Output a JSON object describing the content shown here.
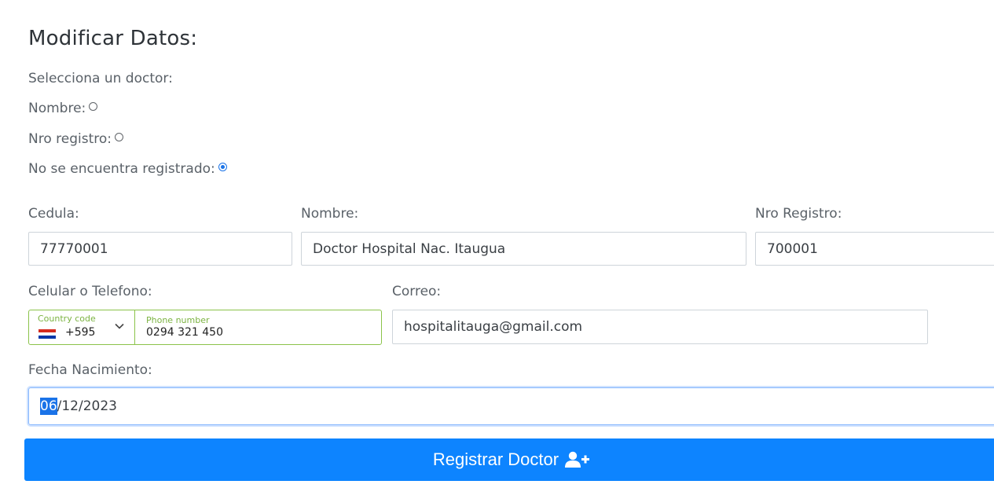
{
  "form": {
    "title": "Modificar Datos:",
    "select_doctor_label": "Selecciona un doctor:",
    "radios": [
      {
        "label": "Nombre:",
        "checked": false
      },
      {
        "label": "Nro registro:",
        "checked": false
      },
      {
        "label": "No se encuentra registrado:",
        "checked": true
      }
    ],
    "cedula": {
      "label": "Cedula:",
      "value": "77770001"
    },
    "nombre": {
      "label": "Nombre:",
      "value": "Doctor Hospital Nac. Itaugua"
    },
    "nro_registro": {
      "label": "Nro Registro:",
      "value": "700001"
    },
    "telefono": {
      "label": "Celular o Telefono:",
      "country_code_label": "Country code",
      "country_code": "+595",
      "country_flag": "paraguay-flag-icon",
      "phone_label": "Phone number",
      "phone": "0294 321 450"
    },
    "correo": {
      "label": "Correo:",
      "value": "hospitalitauga@gmail.com"
    },
    "fecha": {
      "label": "Fecha Nacimiento:",
      "day": "06",
      "rest": "/12/2023"
    },
    "submit": {
      "label": "Registrar Doctor",
      "icon": "user-plus-icon"
    }
  },
  "colors": {
    "accent": "#0d84ff",
    "phone_border": "#8bc34a",
    "radio_checked": "#1a73e8"
  }
}
